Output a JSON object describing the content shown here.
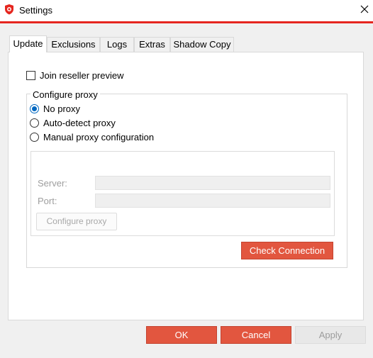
{
  "window": {
    "title": "Settings",
    "accent_color": "#e5261f"
  },
  "tabs": [
    {
      "label": "Update",
      "active": true
    },
    {
      "label": "Exclusions",
      "active": false
    },
    {
      "label": "Logs",
      "active": false
    },
    {
      "label": "Extras",
      "active": false
    },
    {
      "label": "Shadow Copy",
      "active": false
    }
  ],
  "update": {
    "join_reseller": {
      "label": "Join reseller preview",
      "checked": false
    },
    "proxy_group": {
      "legend": "Configure proxy",
      "options": [
        {
          "label": "No proxy",
          "selected": true
        },
        {
          "label": "Auto-detect proxy",
          "selected": false
        },
        {
          "label": "Manual proxy configuration",
          "selected": false
        }
      ],
      "manual": {
        "server_label": "Server:",
        "server_value": "",
        "port_label": "Port:",
        "port_value": "",
        "configure_button": "Configure proxy"
      },
      "check_connection_button": "Check Connection"
    }
  },
  "footer": {
    "ok_label": "OK",
    "cancel_label": "Cancel",
    "apply_label": "Apply"
  },
  "icons": {
    "app": "shield-icon",
    "close": "close-icon"
  },
  "colors": {
    "button_red": "#e2563f",
    "radio_selected": "#0067c0"
  }
}
